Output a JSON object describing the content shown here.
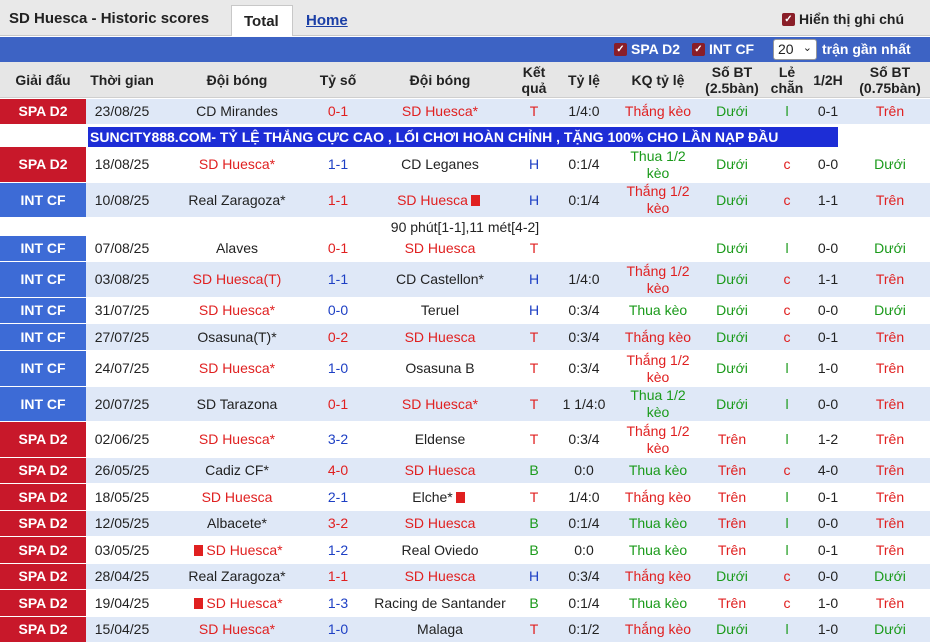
{
  "header": {
    "title": "SD Huesca - Historic scores",
    "tab_total": "Total",
    "tab_home": "Home",
    "show_label": "Hiển thị ghi chú"
  },
  "filters": {
    "spa_d2": "SPA D2",
    "int_cf": "INT CF",
    "count_value": "20",
    "recent_label": "trận gần nhất"
  },
  "columns": [
    "Giải đấu",
    "Thời gian",
    "Đội bóng",
    "Tỷ số",
    "Đội bóng",
    "Kết quả",
    "Tỷ lệ",
    "KQ tỷ lệ",
    "Số BT (2.5bàn)",
    "Lẻ chẵn",
    "1/2H",
    "Số BT (0.75bàn)"
  ],
  "ad_text": "SUNCITY888.COM- TỶ LỆ THẮNG CỰC CAO , LỐI CHƠI HOÀN CHỈNH , TẶNG 100% CHO LẦN NẠP ĐẦU",
  "note_text": "90 phút[1-1],11 mét[4-2]",
  "rows": [
    {
      "league": "SPA D2",
      "date": "23/08/25",
      "home": "CD Mirandes",
      "score": "0-1",
      "away": "SD Huesca*",
      "result": "T",
      "odds": "1/4:0",
      "odds_result": "Thắng kèo",
      "ou25": "Dưới",
      "oe": "l",
      "half": "0-1",
      "ou075": "Trên"
    },
    {
      "league": "SPA D2",
      "date": "18/08/25",
      "home": "SD Huesca*",
      "score": "1-1",
      "away": "CD Leganes",
      "result": "H",
      "odds": "0:1/4",
      "odds_result": "Thua 1/2 kèo",
      "ou25": "Dưới",
      "oe": "c",
      "half": "0-0",
      "ou075": "Dưới"
    },
    {
      "league": "INT CF",
      "date": "10/08/25",
      "home": "Real Zaragoza*",
      "score": "1-1",
      "away": "SD Huesca",
      "result": "H",
      "odds": "0:1/4",
      "odds_result": "Thắng 1/2 kèo",
      "ou25": "Dưới",
      "oe": "c",
      "half": "1-1",
      "ou075": "Trên"
    },
    {
      "league": "INT CF",
      "date": "07/08/25",
      "home": "Alaves",
      "score": "0-1",
      "away": "SD Huesca",
      "result": "T",
      "odds": "",
      "odds_result": "",
      "ou25": "Dưới",
      "oe": "l",
      "half": "0-0",
      "ou075": "Dưới"
    },
    {
      "league": "INT CF",
      "date": "03/08/25",
      "home": "SD Huesca(T)",
      "score": "1-1",
      "away": "CD Castellon*",
      "result": "H",
      "odds": "1/4:0",
      "odds_result": "Thắng 1/2 kèo",
      "ou25": "Dưới",
      "oe": "c",
      "half": "1-1",
      "ou075": "Trên"
    },
    {
      "league": "INT CF",
      "date": "31/07/25",
      "home": "SD Huesca*",
      "score": "0-0",
      "away": "Teruel",
      "result": "H",
      "odds": "0:3/4",
      "odds_result": "Thua kèo",
      "ou25": "Dưới",
      "oe": "c",
      "half": "0-0",
      "ou075": "Dưới"
    },
    {
      "league": "INT CF",
      "date": "27/07/25",
      "home": "Osasuna(T)*",
      "score": "0-2",
      "away": "SD Huesca",
      "result": "T",
      "odds": "0:3/4",
      "odds_result": "Thắng kèo",
      "ou25": "Dưới",
      "oe": "c",
      "half": "0-1",
      "ou075": "Trên"
    },
    {
      "league": "INT CF",
      "date": "24/07/25",
      "home": "SD Huesca*",
      "score": "1-0",
      "away": "Osasuna B",
      "result": "T",
      "odds": "0:3/4",
      "odds_result": "Thắng 1/2 kèo",
      "ou25": "Dưới",
      "oe": "l",
      "half": "1-0",
      "ou075": "Trên"
    },
    {
      "league": "INT CF",
      "date": "20/07/25",
      "home": "SD Tarazona",
      "score": "0-1",
      "away": "SD Huesca*",
      "result": "T",
      "odds": "1 1/4:0",
      "odds_result": "Thua 1/2 kèo",
      "ou25": "Dưới",
      "oe": "l",
      "half": "0-0",
      "ou075": "Trên"
    },
    {
      "league": "SPA D2",
      "date": "02/06/25",
      "home": "SD Huesca*",
      "score": "3-2",
      "away": "Eldense",
      "result": "T",
      "odds": "0:3/4",
      "odds_result": "Thắng 1/2 kèo",
      "ou25": "Trên",
      "oe": "l",
      "half": "1-2",
      "ou075": "Trên"
    },
    {
      "league": "SPA D2",
      "date": "26/05/25",
      "home": "Cadiz CF*",
      "score": "4-0",
      "away": "SD Huesca",
      "result": "B",
      "odds": "0:0",
      "odds_result": "Thua kèo",
      "ou25": "Trên",
      "oe": "c",
      "half": "4-0",
      "ou075": "Trên"
    },
    {
      "league": "SPA D2",
      "date": "18/05/25",
      "home": "SD Huesca",
      "score": "2-1",
      "away": "Elche*",
      "result": "T",
      "odds": "1/4:0",
      "odds_result": "Thắng kèo",
      "ou25": "Trên",
      "oe": "l",
      "half": "0-1",
      "ou075": "Trên"
    },
    {
      "league": "SPA D2",
      "date": "12/05/25",
      "home": "Albacete*",
      "score": "3-2",
      "away": "SD Huesca",
      "result": "B",
      "odds": "0:1/4",
      "odds_result": "Thua kèo",
      "ou25": "Trên",
      "oe": "l",
      "half": "0-0",
      "ou075": "Trên"
    },
    {
      "league": "SPA D2",
      "date": "03/05/25",
      "home": "SD Huesca*",
      "score": "1-2",
      "away": "Real Oviedo",
      "result": "B",
      "odds": "0:0",
      "odds_result": "Thua kèo",
      "ou25": "Trên",
      "oe": "l",
      "half": "0-1",
      "ou075": "Trên"
    },
    {
      "league": "SPA D2",
      "date": "28/04/25",
      "home": "Real Zaragoza*",
      "score": "1-1",
      "away": "SD Huesca",
      "result": "H",
      "odds": "0:3/4",
      "odds_result": "Thắng kèo",
      "ou25": "Dưới",
      "oe": "c",
      "half": "0-0",
      "ou075": "Dưới"
    },
    {
      "league": "SPA D2",
      "date": "19/04/25",
      "home": "SD Huesca*",
      "score": "1-3",
      "away": "Racing de Santander",
      "result": "B",
      "odds": "0:1/4",
      "odds_result": "Thua kèo",
      "ou25": "Trên",
      "oe": "c",
      "half": "1-0",
      "ou075": "Trên"
    },
    {
      "league": "SPA D2",
      "date": "15/04/25",
      "home": "SD Huesca*",
      "score": "1-0",
      "away": "Malaga",
      "result": "T",
      "odds": "0:1/2",
      "odds_result": "Thắng kèo",
      "ou25": "Dưới",
      "oe": "l",
      "half": "1-0",
      "ou075": "Dưới"
    }
  ]
}
